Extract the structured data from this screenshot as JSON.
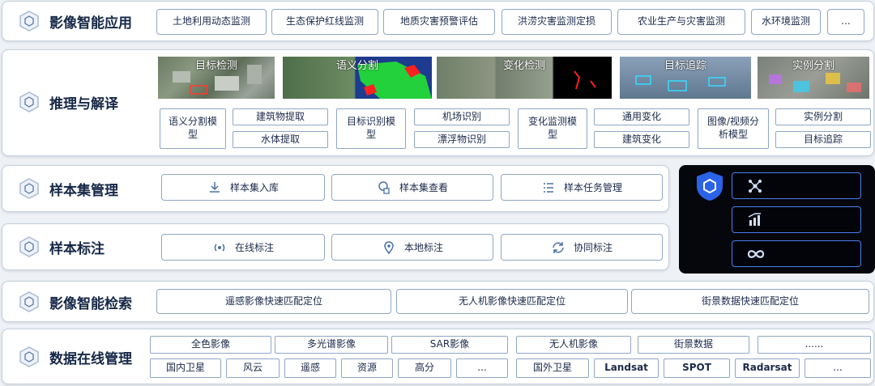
{
  "app_row": {
    "title": "影像智能应用",
    "items": [
      "土地利用动态监测",
      "生态保护红线监测",
      "地质灾害预警评估",
      "洪涝灾害监测定损",
      "农业生产与灾害监测",
      "水环境监测",
      "..."
    ]
  },
  "inference_row": {
    "title": "推理与解译",
    "images": [
      "目标检测",
      "语义分割",
      "变化检测",
      "目标追踪",
      "实例分割"
    ],
    "models": {
      "m1_main": "语义分割模型",
      "m1_sub": [
        "建筑物提取",
        "水体提取"
      ],
      "m2_main": "目标识别模型",
      "m2_sub": [
        "机场识别",
        "漂浮物识别"
      ],
      "m3_main": "变化监测模型",
      "m3_sub": [
        "通用变化",
        "建筑变化"
      ],
      "m4_main": "图像/视频分析模型",
      "m4_sub": [
        "实例分割",
        "目标追踪"
      ]
    }
  },
  "sample_set_row": {
    "title": "样本集管理",
    "items": [
      "样本集入库",
      "样本集查看",
      "样本任务管理"
    ]
  },
  "annotation_row": {
    "title": "样本标注",
    "items": [
      "在线标注",
      "本地标注",
      "协同标注"
    ]
  },
  "search_row": {
    "title": "影像智能检索",
    "items": [
      "遥感影像快速匹配定位",
      "无人机影像快速匹配定位",
      "街景数据快速匹配定位"
    ]
  },
  "data_row": {
    "title": "数据在线管理",
    "top": [
      "全色影像",
      "多光谱影像",
      "SAR影像",
      "无人机影像",
      "街景数据",
      "......"
    ],
    "bottom_left": [
      "国内卫星",
      "风云",
      "遥感",
      "资源",
      "高分",
      "..."
    ],
    "bottom_right": [
      "国外卫星",
      "Landsat",
      "SPOT",
      "Radarsat",
      "..."
    ]
  },
  "side_panel": {
    "icons": [
      "shield-cube-icon",
      "network-icon",
      "chart-icon",
      "infinity-icon"
    ]
  }
}
